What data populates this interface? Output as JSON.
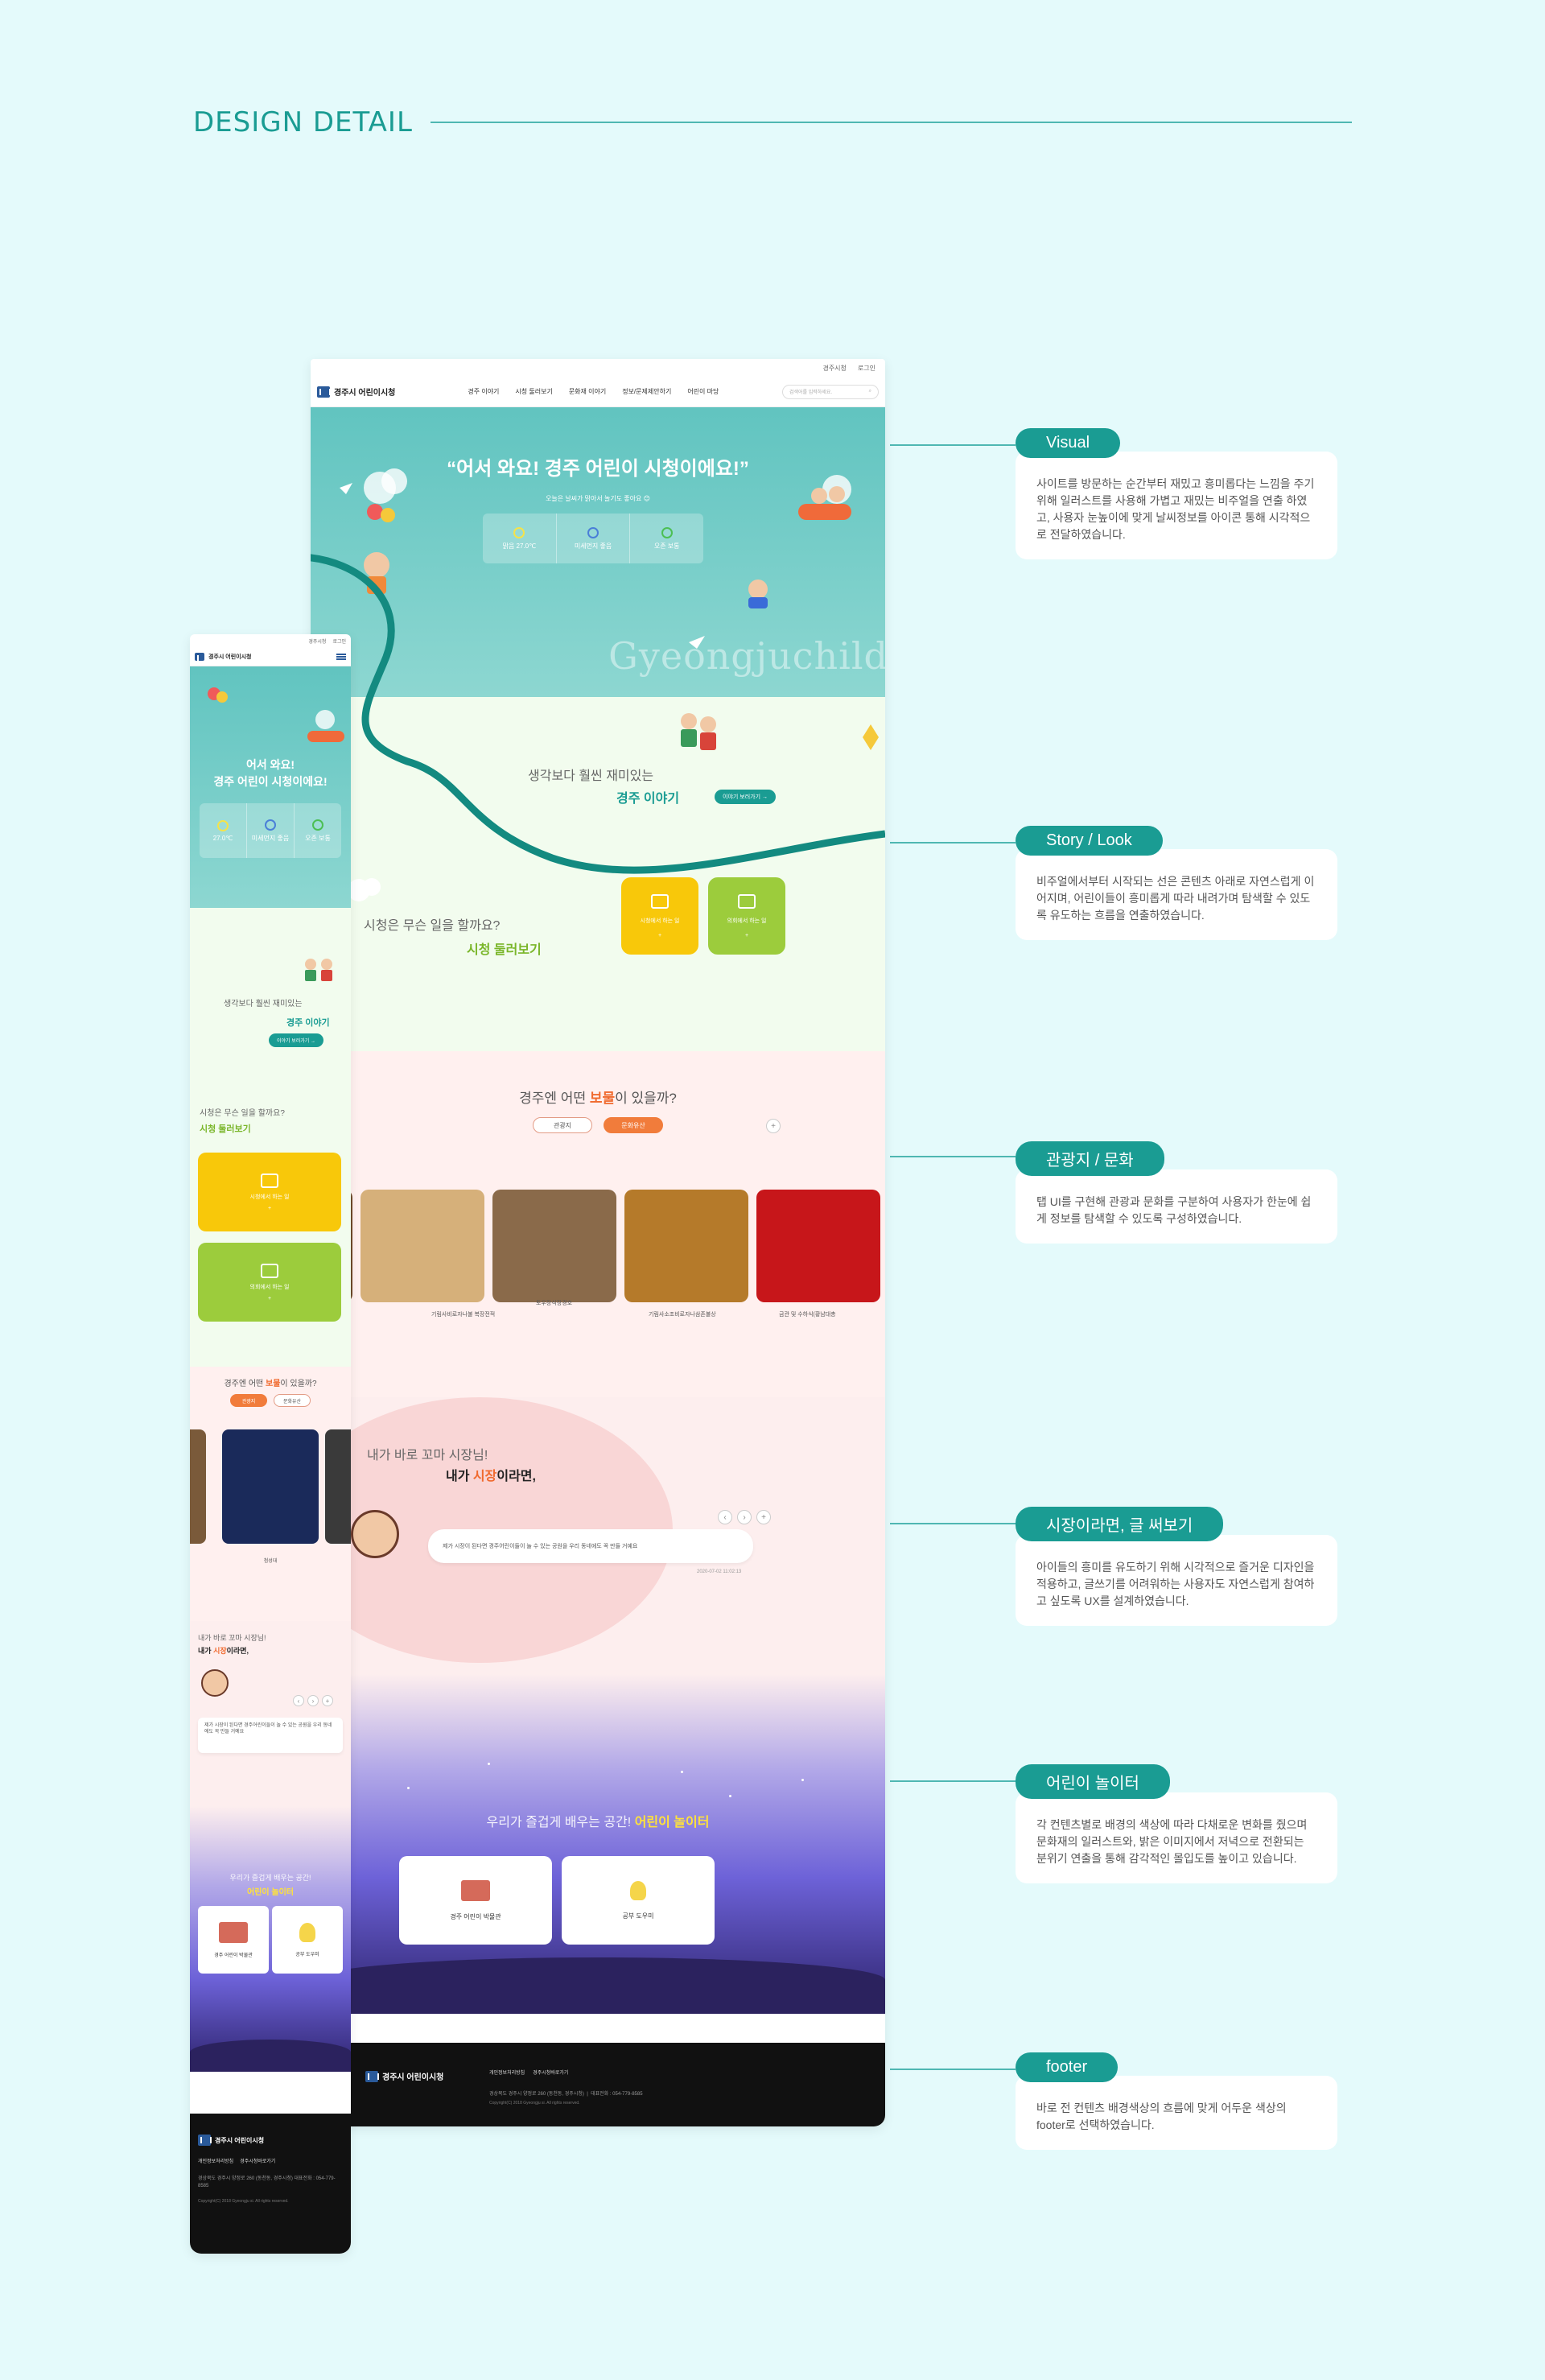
{
  "page": {
    "title": "DESIGN DETAIL"
  },
  "site": {
    "name": "경주시 어린이시청",
    "util": [
      "경주시청",
      "로그인"
    ],
    "menu": [
      "경주 이야기",
      "시청 둘러보기",
      "문화재 이야기",
      "정보/문제제안하기",
      "어린이 마당"
    ],
    "search_placeholder": "검색어를 입력하세요."
  },
  "visual": {
    "headline": "“어서 와요! 경주 어린이 시청이에요!”",
    "sub": "오늘은 날씨가 맑아서 놀기도 좋아요 😊",
    "weather": [
      {
        "label": "맑음 27.0℃",
        "icon": "sun-icon"
      },
      {
        "label": "미세먼지 좋음",
        "icon": "face-icon"
      },
      {
        "label": "오존 보통",
        "icon": "smile-icon"
      }
    ],
    "brand_text": "Gyeongjuchild"
  },
  "story": {
    "line1": "생각보다 훨씬 재미있는",
    "line2": "경주 이야기",
    "button": "이야기 보러가기"
  },
  "look": {
    "line1": "시청은 무슨 일을 할까요?",
    "line2": "시청 둘러보기",
    "card1": "시청에서 하는 일",
    "card2": "의회에서 하는 일"
  },
  "heritage": {
    "title_pre": "경주엔 어떤 ",
    "title_hl": "보물",
    "title_post": "이 있을까?",
    "tabs": [
      "관광지",
      "문화유산"
    ],
    "captions": [
      "기림사비로자나불 복장전적",
      "토우장식장경호",
      "기림사소조비로자나삼존불상",
      "금관 및 수하식(황남대총"
    ],
    "colors": [
      "#6d4a2a",
      "#d6b07a",
      "#8a6a4a",
      "#b57a2a",
      "#c7161a"
    ]
  },
  "mayor": {
    "line1": "내가 바로 꼬마 시장님!",
    "line2_pre": "내가 ",
    "line2_hl": "시장",
    "line2_post": "이라면,",
    "message": "제가 시장이 된다면 경주어린이들이 놀 수 있는 공원을 우리 동네에도 꼭 만들 거예요",
    "date": "2020-07-02 11:02:13"
  },
  "play": {
    "line1": "우리가 즐겁게 배우는 공간!",
    "line2": "어린이 놀이터",
    "card1": "경주 어린이 박물관",
    "card2": "공부 도우미"
  },
  "footer": {
    "links": [
      "개인정보처리방침",
      "경주시청바로가기"
    ],
    "address": "경상북도 경주시 양정로 260 (동천동, 경주시청)",
    "tel": "대표전화 : 054-779-8585",
    "copyright": "Copyright(C) 2018 Gyeongju si. All rights reserved."
  },
  "mobile": {
    "headline_1": "어서 와요!",
    "headline_2": "경주 어린이 시청이에요!",
    "weather": [
      "27.0℃",
      "미세먼지 좋음",
      "오존 보통"
    ],
    "heritage_caption": "첨성대",
    "mayor_message": "제가 시장이 된다면 경주어린이들이 놀 수 있는 공원을 우리 동네에도 꼭 만들 거예요",
    "address": "경상북도 경주시 양정로 260 (동천동, 경주시청) 대표전화 : 054-779-8585",
    "copyright": "Copyright(C) 2018 Gyeongju si. All rights reserved."
  },
  "annotations": [
    {
      "tag": "Visual",
      "text": "사이트를 방문하는 순간부터 재밌고 흥미롭다는 느낌을 주기위해 일러스트를 사용해 가볍고 재밌는 비주얼을 연출 하였고, 사용자 눈높이에 맞게 날씨정보를 아이콘 통해 시각적으로 전달하였습니다."
    },
    {
      "tag": "Story / Look",
      "text": "비주얼에서부터 시작되는 선은 콘텐츠 아래로 자연스럽게 이어지며, 어린이들이 흥미롭게 따라 내려가며 탐색할 수 있도록 유도하는 흐름을 연출하였습니다."
    },
    {
      "tag": "관광지 / 문화",
      "text": "탭 UI를 구현해 관광과 문화를 구분하여 사용자가 한눈에 쉽게 정보를 탐색할 수 있도록 구성하였습니다."
    },
    {
      "tag": "시장이라면, 글 써보기",
      "text": "아이들의 흥미를 유도하기 위해 시각적으로 즐거운 디자인을 적용하고, 글쓰기를 어려워하는 사용자도 자연스럽게 참여하고 싶도록 UX를 설계하였습니다."
    },
    {
      "tag": "어린이 놀이터",
      "text": "각 컨텐츠별로 배경의 색상에 따라 다채로운 변화를 줬으며 문화재의 일러스트와, 밝은 이미지에서 저녁으로 전환되는 분위기 연출을 통해 감각적인 몰입도를 높이고 있습니다."
    },
    {
      "tag": "footer",
      "text": "바로 전 컨텐츠 배경색상의 흐름에 맞게 어두운 색상의 footer로 선택하였습니다."
    }
  ]
}
